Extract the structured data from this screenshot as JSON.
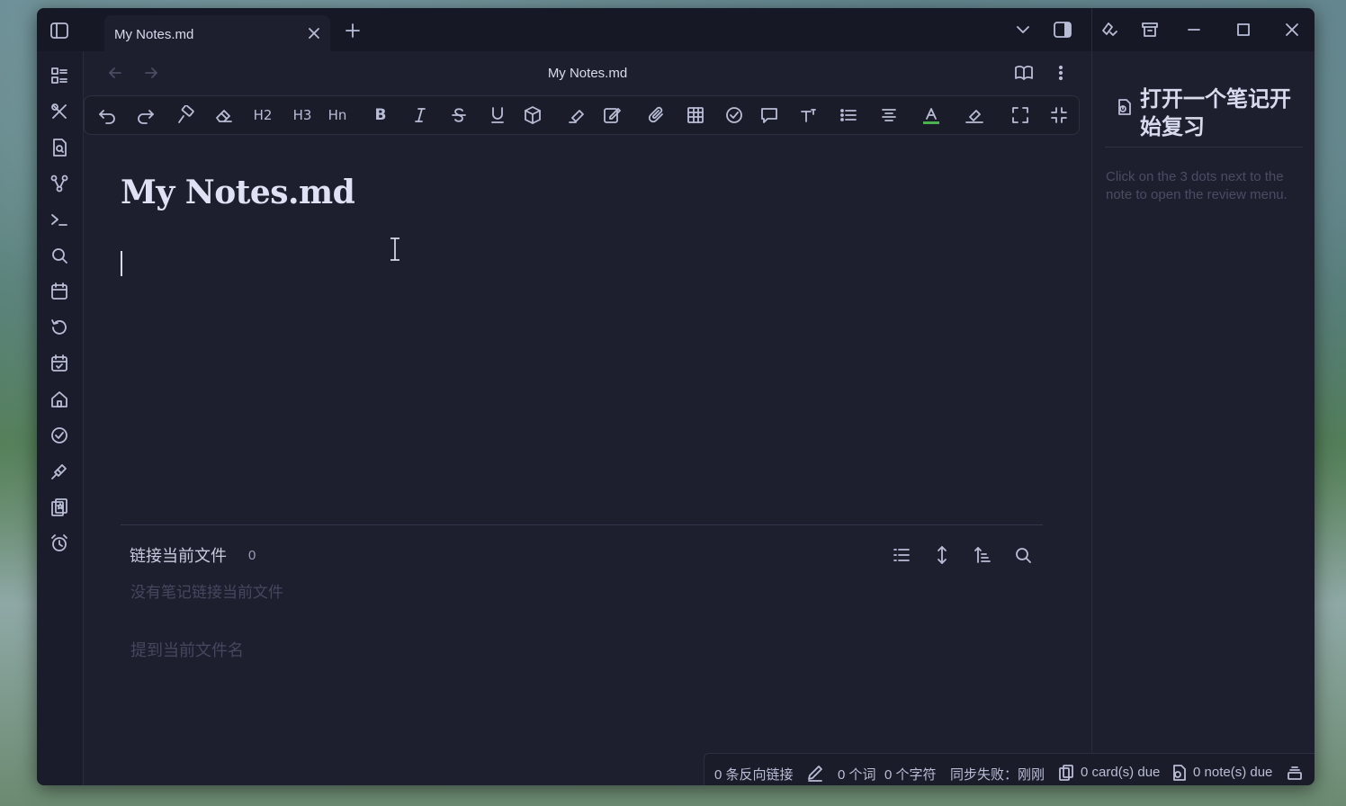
{
  "tab": {
    "title": "My Notes.md"
  },
  "nav": {
    "title": "My Notes.md"
  },
  "toolbar": {
    "h2": "H2",
    "h3": "H3",
    "hn": "Hn",
    "bold": "B",
    "text_color_accent": "#4caf50"
  },
  "document": {
    "title": "My Notes.md"
  },
  "backlinks": {
    "title": "链接当前文件",
    "count": "0",
    "empty_text": "没有笔记链接当前文件",
    "mentions_title": "提到当前文件名"
  },
  "review_pane": {
    "heading": "打开一个笔记开始复习",
    "hint": "Click on the 3 dots next to the note to open the review menu."
  },
  "statusbar": {
    "backlinks": "0 条反向链接",
    "words": "0 个词",
    "chars": "0 个字符",
    "sync": "同步失败：刚刚",
    "cards_due": "0 card(s) due",
    "notes_due": "0 note(s) due"
  }
}
